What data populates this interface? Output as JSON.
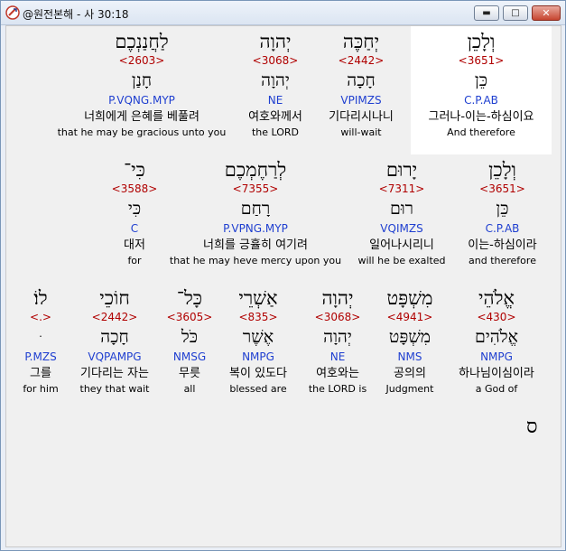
{
  "window": {
    "title": "@원전본해 - 사 30:18"
  },
  "controls": {
    "minimize": "▬",
    "maximize": "□",
    "close": "✕"
  },
  "rows": [
    {
      "cells": [
        {
          "heb": "לַחֲנַנְכֶם",
          "strong": "<2603>",
          "lemma": "חָנַן",
          "parse": "P.VQNG.MYP",
          "kor": "너희에게 은혜를 베풀려",
          "eng": "that he may be gracious unto you"
        },
        {
          "heb": "יְהוָה",
          "strong": "<3068>",
          "lemma": "יְהוָה",
          "parse": "NE",
          "kor": "여호와께서",
          "eng": "the LORD"
        },
        {
          "heb": "יְחַכֶּה",
          "strong": "<2442>",
          "lemma": "חָכָה",
          "parse": "VPIMZS",
          "kor": "기다리시나니",
          "eng": "will-wait"
        },
        {
          "heb": "וְלָכֵן",
          "strong": "<3651>",
          "lemma": "כֵּן",
          "parse": "C.P.AB",
          "kor": "그러나-이는-하심이요",
          "eng": "And therefore"
        }
      ]
    },
    {
      "cells": [
        {
          "heb": "כִּי־",
          "strong": "<3588>",
          "lemma": "כִּי",
          "parse": "C",
          "kor": "대저",
          "eng": "for"
        },
        {
          "heb": "לְרַחֶמְכֶם",
          "strong": "<7355>",
          "lemma": "רָחַם",
          "parse": "P.VPNG.MYP",
          "kor": "너희를 긍휼히 여기려",
          "eng": "that he may heve mercy upon you"
        },
        {
          "heb": "יָרוּם",
          "strong": "<7311>",
          "lemma": "רוּם",
          "parse": "VQIMZS",
          "kor": "일어나시리니",
          "eng": "will he be exalted"
        },
        {
          "heb": "וְלָכֵן",
          "strong": "<3651>",
          "lemma": "כֵּן",
          "parse": "C.P.AB",
          "kor": "이는-하심이라",
          "eng": "and therefore"
        }
      ]
    },
    {
      "cells": [
        {
          "heb": "לוֹ׃",
          "strong": "<.>",
          "lemma": "ּ",
          "parse": "P.MZS",
          "kor": "그를",
          "eng": "for him"
        },
        {
          "heb": "חוֹכֵי",
          "strong": "<2442>",
          "lemma": "חָכָה",
          "parse": "VQPAMPG",
          "kor": "기다리는 자는",
          "eng": "they that wait"
        },
        {
          "heb": "כָּל־",
          "strong": "<3605>",
          "lemma": "כֹּל",
          "parse": "NMSG",
          "kor": "무릇",
          "eng": "all"
        },
        {
          "heb": "אַשְׁרֵי",
          "strong": "<835>",
          "lemma": "אֶשֶׁר",
          "parse": "NMPG",
          "kor": "복이 있도다",
          "eng": "blessed are"
        },
        {
          "heb": "יְהוָה",
          "strong": "<3068>",
          "lemma": "יְהוָה",
          "parse": "NE",
          "kor": "여호와는",
          "eng": "the LORD is"
        },
        {
          "heb": "מִשְׁפָּט",
          "strong": "<4941>",
          "lemma": "מִשְׁפָּט",
          "parse": "NMS",
          "kor": "공의의",
          "eng": "Judgment"
        },
        {
          "heb": "אֱלֹהֵי",
          "strong": "<430>",
          "lemma": "אֱלֹהִים",
          "parse": "NMPG",
          "kor": "하나님이심이라",
          "eng": "a God of"
        }
      ]
    }
  ],
  "paragraph_mark": "ס"
}
